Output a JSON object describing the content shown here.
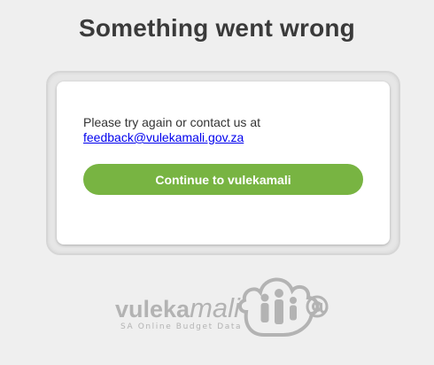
{
  "page": {
    "title": "Something went wrong"
  },
  "card": {
    "message": "Please try again or contact us at",
    "email_link": "feedback@vulekamali.gov.za",
    "continue_label": "Continue to vulekamali"
  },
  "logo": {
    "wordmark": "vulekamali",
    "tagline": "SA Online Budget Data"
  },
  "colors": {
    "button": "#78b442",
    "logo": "#b3b3b3"
  }
}
